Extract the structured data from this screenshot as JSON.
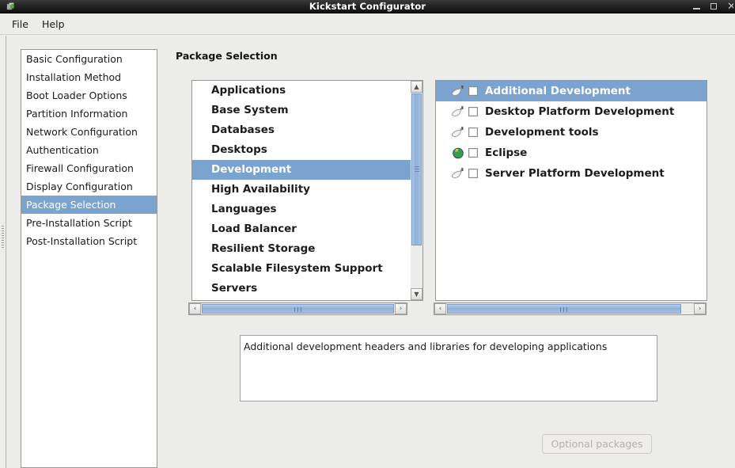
{
  "window": {
    "title": "Kickstart Configurator",
    "icon": "app-icon",
    "controls": {
      "minimize": "–",
      "maximize": "□",
      "close": "✕"
    }
  },
  "menubar": {
    "items": [
      {
        "label": "File"
      },
      {
        "label": "Help"
      }
    ]
  },
  "sidebar": {
    "items": [
      {
        "label": "Basic Configuration",
        "selected": false
      },
      {
        "label": "Installation Method",
        "selected": false
      },
      {
        "label": "Boot Loader Options",
        "selected": false
      },
      {
        "label": "Partition Information",
        "selected": false
      },
      {
        "label": "Network Configuration",
        "selected": false
      },
      {
        "label": "Authentication",
        "selected": false
      },
      {
        "label": "Firewall Configuration",
        "selected": false
      },
      {
        "label": "Display Configuration",
        "selected": false
      },
      {
        "label": "Package Selection",
        "selected": true
      },
      {
        "label": "Pre-Installation Script",
        "selected": false
      },
      {
        "label": "Post-Installation Script",
        "selected": false
      }
    ]
  },
  "main": {
    "section_title": "Package Selection",
    "category_list": {
      "items": [
        {
          "label": "Applications",
          "selected": false
        },
        {
          "label": "Base System",
          "selected": false
        },
        {
          "label": "Databases",
          "selected": false
        },
        {
          "label": "Desktops",
          "selected": false
        },
        {
          "label": "Development",
          "selected": true
        },
        {
          "label": "High Availability",
          "selected": false
        },
        {
          "label": "Languages",
          "selected": false
        },
        {
          "label": "Load Balancer",
          "selected": false
        },
        {
          "label": "Resilient Storage",
          "selected": false
        },
        {
          "label": "Scalable Filesystem Support",
          "selected": false
        },
        {
          "label": "Servers",
          "selected": false
        }
      ],
      "vscroll_arrow_up": "▲",
      "vscroll_arrow_down": "▼",
      "hscroll_arrow_left": "‹",
      "hscroll_arrow_right": "›"
    },
    "group_list": {
      "items": [
        {
          "label": "Additional Development",
          "checked": false,
          "selected": true,
          "icon": "package-group-icon"
        },
        {
          "label": "Desktop Platform Development",
          "checked": false,
          "selected": false,
          "icon": "package-group-icon"
        },
        {
          "label": "Development tools",
          "checked": false,
          "selected": false,
          "icon": "package-group-icon"
        },
        {
          "label": "Eclipse",
          "checked": false,
          "selected": false,
          "icon": "globe-icon"
        },
        {
          "label": "Server Platform Development",
          "checked": false,
          "selected": false,
          "icon": "package-group-icon"
        }
      ],
      "hscroll_arrow_left": "‹",
      "hscroll_arrow_right": "›"
    },
    "description": "Additional development headers and libraries for developing applications",
    "optional_packages_button": {
      "label": "Optional packages",
      "enabled": false
    }
  },
  "colors": {
    "selection_blue": "#7ba3d0",
    "window_bg": "#ececeb",
    "list_bg": "#ffffff",
    "titlebar_dark": "#1b1b1b",
    "scrollbar_thumb": "#90b0d8"
  }
}
